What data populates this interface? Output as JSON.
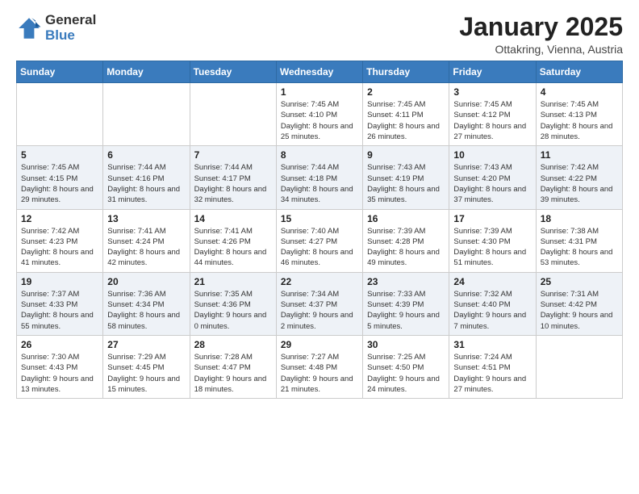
{
  "logo": {
    "general": "General",
    "blue": "Blue"
  },
  "title": "January 2025",
  "subtitle": "Ottakring, Vienna, Austria",
  "weekdays": [
    "Sunday",
    "Monday",
    "Tuesday",
    "Wednesday",
    "Thursday",
    "Friday",
    "Saturday"
  ],
  "weeks": [
    [
      {
        "day": "",
        "info": ""
      },
      {
        "day": "",
        "info": ""
      },
      {
        "day": "",
        "info": ""
      },
      {
        "day": "1",
        "info": "Sunrise: 7:45 AM\nSunset: 4:10 PM\nDaylight: 8 hours and 25 minutes."
      },
      {
        "day": "2",
        "info": "Sunrise: 7:45 AM\nSunset: 4:11 PM\nDaylight: 8 hours and 26 minutes."
      },
      {
        "day": "3",
        "info": "Sunrise: 7:45 AM\nSunset: 4:12 PM\nDaylight: 8 hours and 27 minutes."
      },
      {
        "day": "4",
        "info": "Sunrise: 7:45 AM\nSunset: 4:13 PM\nDaylight: 8 hours and 28 minutes."
      }
    ],
    [
      {
        "day": "5",
        "info": "Sunrise: 7:45 AM\nSunset: 4:15 PM\nDaylight: 8 hours and 29 minutes."
      },
      {
        "day": "6",
        "info": "Sunrise: 7:44 AM\nSunset: 4:16 PM\nDaylight: 8 hours and 31 minutes."
      },
      {
        "day": "7",
        "info": "Sunrise: 7:44 AM\nSunset: 4:17 PM\nDaylight: 8 hours and 32 minutes."
      },
      {
        "day": "8",
        "info": "Sunrise: 7:44 AM\nSunset: 4:18 PM\nDaylight: 8 hours and 34 minutes."
      },
      {
        "day": "9",
        "info": "Sunrise: 7:43 AM\nSunset: 4:19 PM\nDaylight: 8 hours and 35 minutes."
      },
      {
        "day": "10",
        "info": "Sunrise: 7:43 AM\nSunset: 4:20 PM\nDaylight: 8 hours and 37 minutes."
      },
      {
        "day": "11",
        "info": "Sunrise: 7:42 AM\nSunset: 4:22 PM\nDaylight: 8 hours and 39 minutes."
      }
    ],
    [
      {
        "day": "12",
        "info": "Sunrise: 7:42 AM\nSunset: 4:23 PM\nDaylight: 8 hours and 41 minutes."
      },
      {
        "day": "13",
        "info": "Sunrise: 7:41 AM\nSunset: 4:24 PM\nDaylight: 8 hours and 42 minutes."
      },
      {
        "day": "14",
        "info": "Sunrise: 7:41 AM\nSunset: 4:26 PM\nDaylight: 8 hours and 44 minutes."
      },
      {
        "day": "15",
        "info": "Sunrise: 7:40 AM\nSunset: 4:27 PM\nDaylight: 8 hours and 46 minutes."
      },
      {
        "day": "16",
        "info": "Sunrise: 7:39 AM\nSunset: 4:28 PM\nDaylight: 8 hours and 49 minutes."
      },
      {
        "day": "17",
        "info": "Sunrise: 7:39 AM\nSunset: 4:30 PM\nDaylight: 8 hours and 51 minutes."
      },
      {
        "day": "18",
        "info": "Sunrise: 7:38 AM\nSunset: 4:31 PM\nDaylight: 8 hours and 53 minutes."
      }
    ],
    [
      {
        "day": "19",
        "info": "Sunrise: 7:37 AM\nSunset: 4:33 PM\nDaylight: 8 hours and 55 minutes."
      },
      {
        "day": "20",
        "info": "Sunrise: 7:36 AM\nSunset: 4:34 PM\nDaylight: 8 hours and 58 minutes."
      },
      {
        "day": "21",
        "info": "Sunrise: 7:35 AM\nSunset: 4:36 PM\nDaylight: 9 hours and 0 minutes."
      },
      {
        "day": "22",
        "info": "Sunrise: 7:34 AM\nSunset: 4:37 PM\nDaylight: 9 hours and 2 minutes."
      },
      {
        "day": "23",
        "info": "Sunrise: 7:33 AM\nSunset: 4:39 PM\nDaylight: 9 hours and 5 minutes."
      },
      {
        "day": "24",
        "info": "Sunrise: 7:32 AM\nSunset: 4:40 PM\nDaylight: 9 hours and 7 minutes."
      },
      {
        "day": "25",
        "info": "Sunrise: 7:31 AM\nSunset: 4:42 PM\nDaylight: 9 hours and 10 minutes."
      }
    ],
    [
      {
        "day": "26",
        "info": "Sunrise: 7:30 AM\nSunset: 4:43 PM\nDaylight: 9 hours and 13 minutes."
      },
      {
        "day": "27",
        "info": "Sunrise: 7:29 AM\nSunset: 4:45 PM\nDaylight: 9 hours and 15 minutes."
      },
      {
        "day": "28",
        "info": "Sunrise: 7:28 AM\nSunset: 4:47 PM\nDaylight: 9 hours and 18 minutes."
      },
      {
        "day": "29",
        "info": "Sunrise: 7:27 AM\nSunset: 4:48 PM\nDaylight: 9 hours and 21 minutes."
      },
      {
        "day": "30",
        "info": "Sunrise: 7:25 AM\nSunset: 4:50 PM\nDaylight: 9 hours and 24 minutes."
      },
      {
        "day": "31",
        "info": "Sunrise: 7:24 AM\nSunset: 4:51 PM\nDaylight: 9 hours and 27 minutes."
      },
      {
        "day": "",
        "info": ""
      }
    ]
  ]
}
